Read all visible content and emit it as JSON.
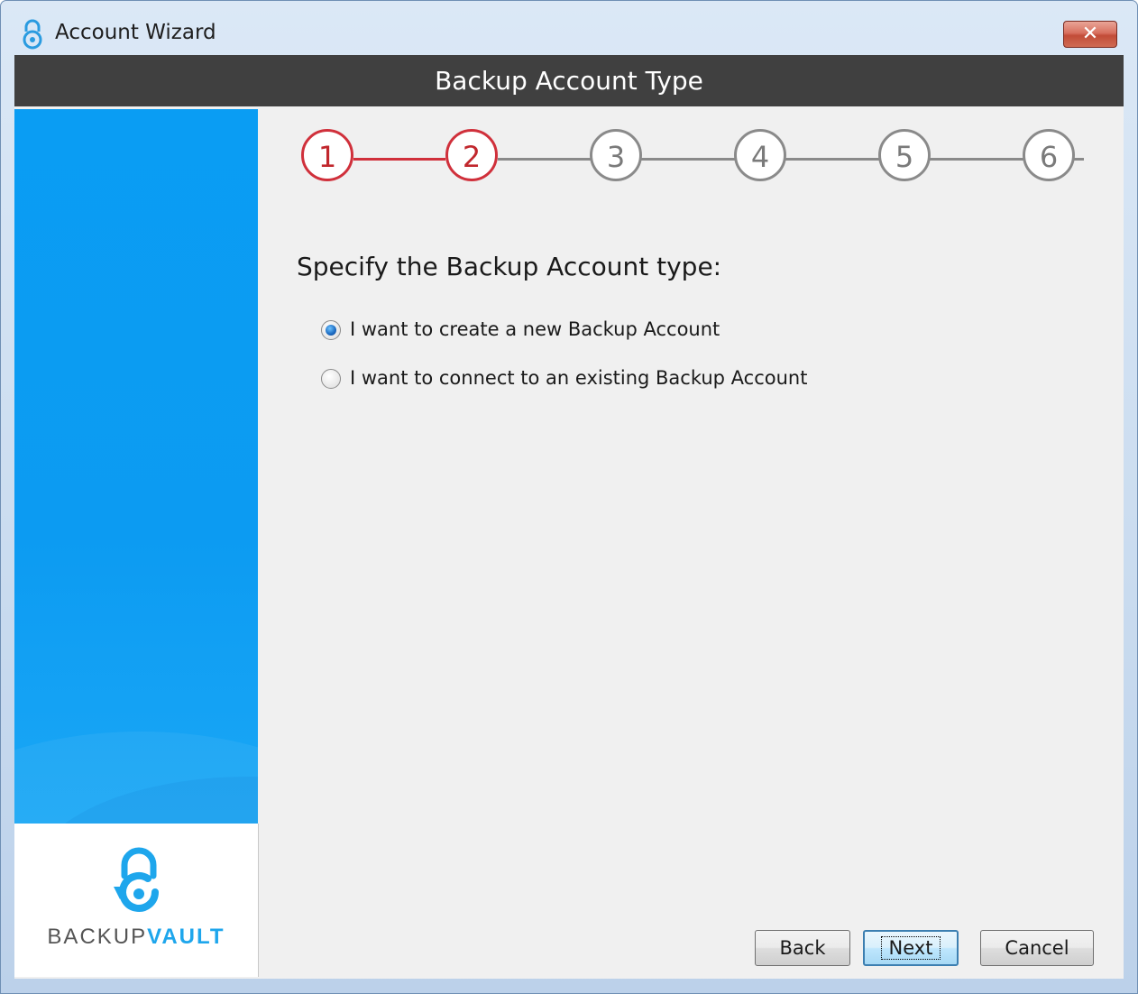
{
  "window": {
    "title": "Account Wizard",
    "close_symbol": "✕",
    "title_icon": "lock-icon"
  },
  "header": {
    "title": "Backup Account Type"
  },
  "steps": {
    "items": [
      "1",
      "2",
      "3",
      "4",
      "5",
      "6"
    ],
    "current": 2,
    "active_color": "#d0303b",
    "inactive_color": "#8a8a8a"
  },
  "content": {
    "prompt": "Specify the Backup Account type:",
    "options": [
      {
        "label": "I want to create a new Backup Account",
        "selected": true
      },
      {
        "label": "I want to connect to an existing Backup Account",
        "selected": false
      }
    ]
  },
  "branding": {
    "logo_icon": "backupvault-lock-icon",
    "logo_word_1": "BACKUP",
    "logo_word_2": "VAULT",
    "brand_color": "#1ea6ec",
    "sidebar_color": "#0a9df3"
  },
  "buttons": {
    "back": "Back",
    "next": "Next",
    "cancel": "Cancel"
  },
  "colors": {
    "header_band": "#404040",
    "dialog_bg": "#f0f0f0"
  }
}
